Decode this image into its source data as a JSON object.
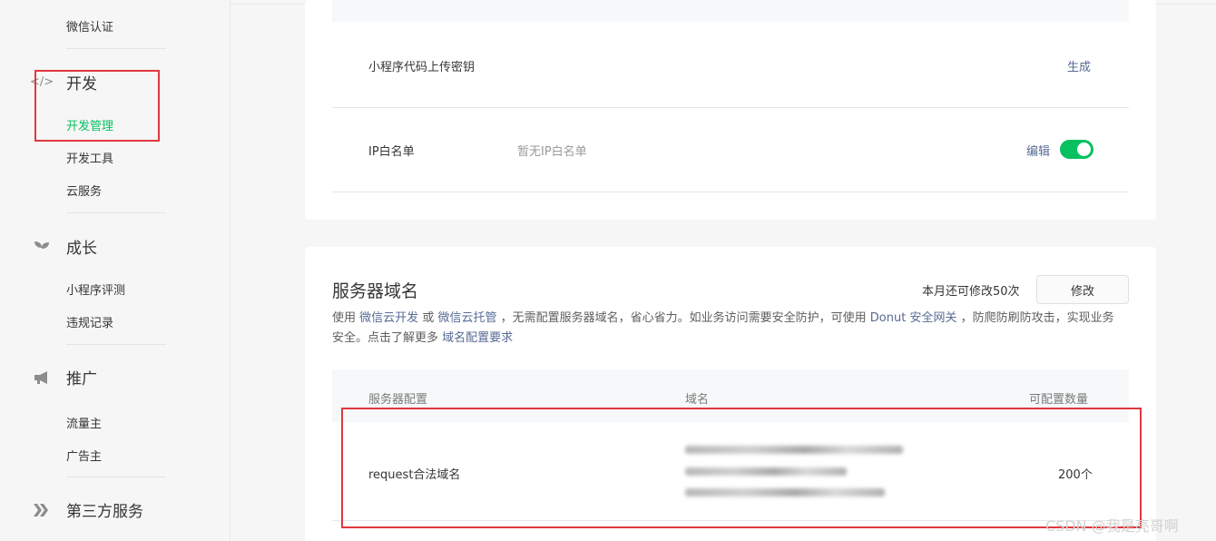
{
  "sidebar": {
    "wechat_auth": "微信认证",
    "dev_group": "开发",
    "dev_icon": "code-icon",
    "dev_mgmt": "开发管理",
    "dev_tools": "开发工具",
    "cloud": "云服务",
    "growth_group": "成长",
    "growth_icon": "sprout-icon",
    "review": "小程序评测",
    "violation": "违规记录",
    "promo_group": "推广",
    "promo_icon": "megaphone-icon",
    "traffic": "流量主",
    "advertiser": "广告主",
    "third_group": "第三方服务",
    "third_icon": "third-party-icon"
  },
  "settings": {
    "upload_key_label": "小程序代码上传密钥",
    "upload_key_action": "生成",
    "ip_label": "IP白名单",
    "ip_value": "暂无IP白名单",
    "ip_action": "编辑"
  },
  "server_domain": {
    "title": "服务器域名",
    "quota": "本月还可修改50次",
    "modify_button": "修改",
    "desc_1": "使用",
    "link_cloud_dev": "微信云开发",
    "desc_2": "或",
    "link_cloud_host": "微信云托管",
    "desc_3": "，无需配置服务器域名，省心省力。如业务访问需要安全防护，可使用",
    "link_donut": "Donut 安全网关",
    "desc_4": "，防爬防刷防攻击，实现业务安全。点击了解更多",
    "link_domain_req": "域名配置要求",
    "columns": [
      "服务器配置",
      "域名",
      "可配置数量"
    ],
    "rows": [
      {
        "config": "request合法域名",
        "count": "200个"
      }
    ]
  },
  "watermark": "CSDN @我是亮哥啊",
  "colors": {
    "accent": "#07c160",
    "link": "#576b95",
    "highlight": "#e0383e"
  }
}
